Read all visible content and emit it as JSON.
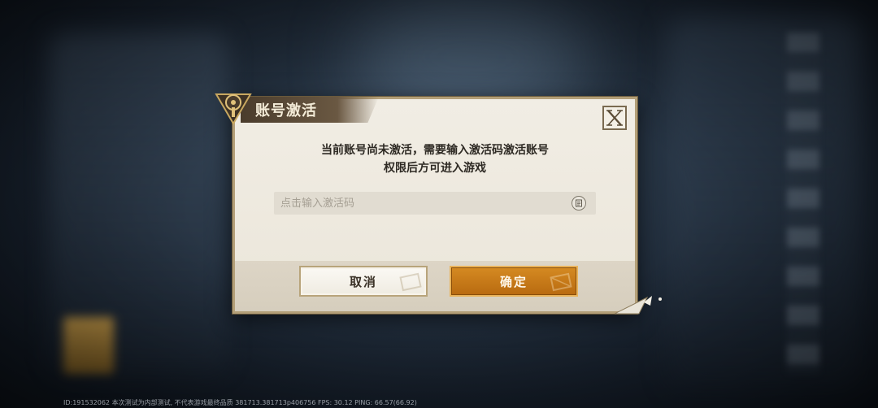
{
  "dialog": {
    "title": "账号激活",
    "message_line1": "当前账号尚未激活，需要输入激活码激活账号",
    "message_line2": "权限后方可进入游戏",
    "input": {
      "placeholder": "点击输入激活码",
      "value": ""
    },
    "cancel_label": "取消",
    "confirm_label": "确定",
    "close_icon": "close-x-icon",
    "paste_icon": "paste-icon"
  },
  "debug": {
    "info": "ID:191532062 本次测试为内部测试, 不代表游戏最终品质 381713.381713p406756 FPS: 30.12 PING: 66.57(66.92)"
  },
  "colors": {
    "accent": "#c27817",
    "dialog_bg": "#f1ede4",
    "title_tab": "#4a3c2c",
    "border": "#b39f78"
  }
}
